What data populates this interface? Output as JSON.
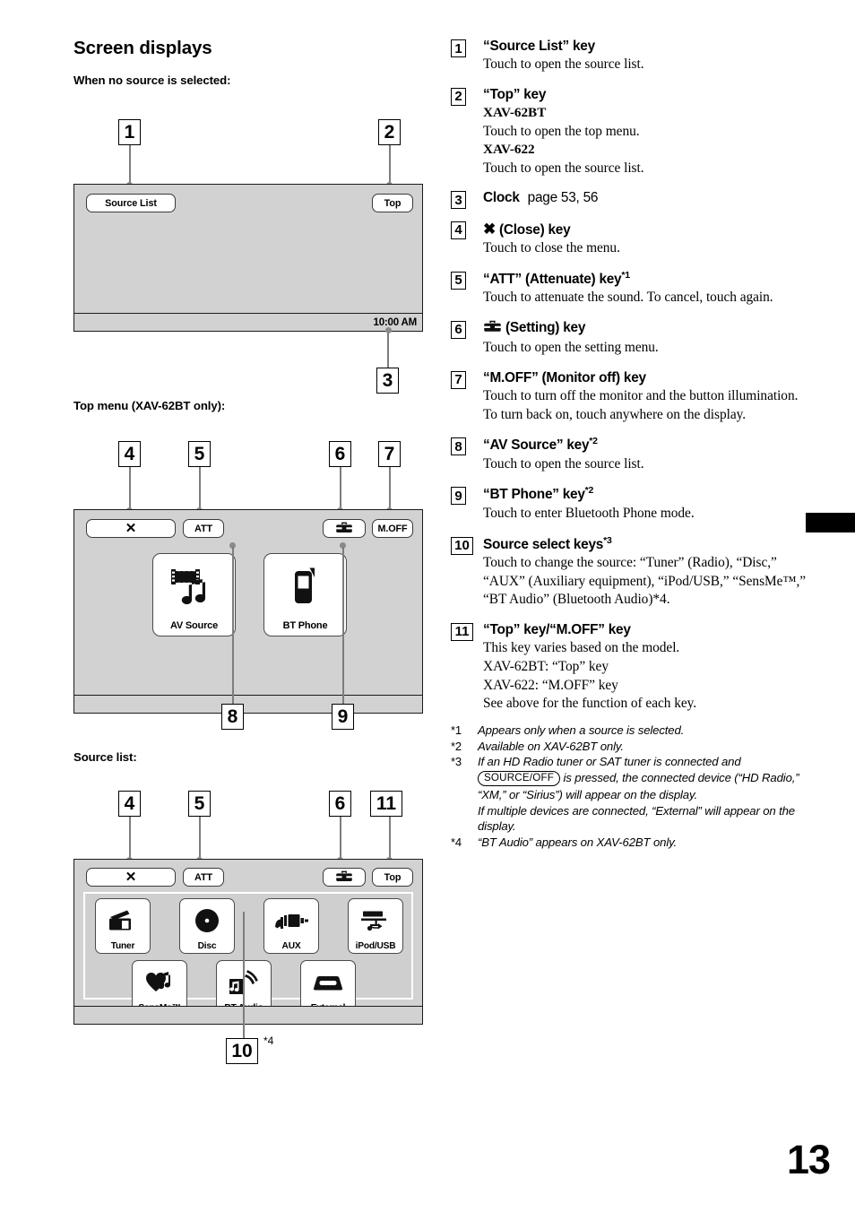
{
  "page": {
    "number": "13",
    "section_title": "Screen displays"
  },
  "left": {
    "fig1": {
      "caption": "When no source is selected:",
      "callouts": [
        {
          "id": "1",
          "label": "1"
        },
        {
          "id": "2",
          "label": "2"
        },
        {
          "id": "3",
          "label": "3"
        }
      ],
      "source_list_button": "Source List",
      "top_button": "Top",
      "clock": "10:00 AM"
    },
    "fig2": {
      "caption": "Top menu (XAV-62BT only):",
      "callouts": [
        {
          "id": "4",
          "label": "4"
        },
        {
          "id": "5",
          "label": "5"
        },
        {
          "id": "6",
          "label": "6"
        },
        {
          "id": "7",
          "label": "7"
        },
        {
          "id": "8",
          "label": "8"
        },
        {
          "id": "9",
          "label": "9"
        }
      ],
      "close_button": "✕",
      "att_button": "ATT",
      "setting_icon": "toolbox-icon",
      "moff_button": "M.OFF",
      "keys": [
        {
          "label": "AV Source",
          "icon": "film-music-icon"
        },
        {
          "label": "BT Phone",
          "icon": "mobile-phone-icon"
        }
      ]
    },
    "fig3": {
      "caption": "Source list:",
      "callouts": [
        {
          "id": "4",
          "label": "4"
        },
        {
          "id": "5",
          "label": "5"
        },
        {
          "id": "6",
          "label": "6"
        },
        {
          "id": "11",
          "label": "11"
        },
        {
          "id": "10",
          "label": "10"
        }
      ],
      "close_button": "✕",
      "att_button": "ATT",
      "setting_icon": "toolbox-icon",
      "top_button": "Top",
      "callout10_note": "*4",
      "row1": [
        {
          "label": "Tuner",
          "icon": "radio-icon"
        },
        {
          "label": "Disc",
          "icon": "disc-icon"
        },
        {
          "label": "AUX",
          "icon": "aux-plug-icon"
        },
        {
          "label": "iPod/USB",
          "icon": "usb-icon"
        }
      ],
      "row2": [
        {
          "label": "SensMe™",
          "icon": "heart-note-icon"
        },
        {
          "label": "BT Audio",
          "icon": "bluetooth-audio-icon"
        },
        {
          "label": "External",
          "icon": "external-device-icon"
        }
      ]
    }
  },
  "right": {
    "items": [
      {
        "num": "1",
        "header": "“Source List” key",
        "lines": [
          {
            "style": "desc",
            "text": "Touch to open the source list."
          }
        ]
      },
      {
        "num": "2",
        "header": "“Top” key",
        "lines": [
          {
            "style": "bold",
            "text": "XAV-62BT"
          },
          {
            "style": "desc",
            "text": "Touch to open the top menu."
          },
          {
            "style": "bold",
            "text": "XAV-622"
          },
          {
            "style": "desc",
            "text": "Touch to open the source list."
          }
        ]
      },
      {
        "num": "3",
        "header": "Clock",
        "header_suffix": "page 53, 56",
        "lines": []
      },
      {
        "num": "4",
        "header": "✖ (Close) key",
        "lines": [
          {
            "style": "desc",
            "text": "Touch to close the menu."
          }
        ]
      },
      {
        "num": "5",
        "header": "“ATT” (Attenuate) key",
        "header_sup": "*1",
        "lines": [
          {
            "style": "desc",
            "text": "Touch to attenuate the sound. To cancel, touch again."
          }
        ]
      },
      {
        "num": "6",
        "header": "(Setting) key",
        "header_icon": "toolbox-icon",
        "lines": [
          {
            "style": "desc",
            "text": "Touch to open the setting menu."
          }
        ]
      },
      {
        "num": "7",
        "header": "“M.OFF” (Monitor off) key",
        "lines": [
          {
            "style": "desc",
            "text": "Touch to turn off the monitor and the button illumination. To turn back on, touch anywhere on the display."
          }
        ]
      },
      {
        "num": "8",
        "header": "“AV Source” key",
        "header_sup": "*2",
        "lines": [
          {
            "style": "desc",
            "text": "Touch to open the source list."
          }
        ]
      },
      {
        "num": "9",
        "header": "“BT Phone” key",
        "header_sup": "*2",
        "lines": [
          {
            "style": "desc",
            "text": "Touch to enter Bluetooth Phone mode."
          }
        ]
      },
      {
        "num": "10",
        "header": "Source select keys",
        "header_sup": "*3",
        "lines": [
          {
            "style": "desc",
            "text": "Touch to change the source: “Tuner” (Radio), “Disc,” “AUX” (Auxiliary equipment), “iPod/USB,” “SensMe™,” “BT Audio” (Bluetooth Audio)*4."
          }
        ]
      },
      {
        "num": "11",
        "header": "“Top” key/“M.OFF” key",
        "lines": [
          {
            "style": "desc",
            "text": "This key varies based on the model."
          },
          {
            "style": "desc",
            "text": "XAV-62BT: “Top” key"
          },
          {
            "style": "desc",
            "text": "XAV-622: “M.OFF” key"
          },
          {
            "style": "desc",
            "text": "See above for the function of each key."
          }
        ]
      }
    ],
    "footnotes": [
      {
        "mark": "*1",
        "text": "Appears only when a source is selected."
      },
      {
        "mark": "*2",
        "text": "Available on XAV-62BT only."
      },
      {
        "mark": "*3",
        "pre": "If an HD Radio tuner or SAT tuner is connected and ",
        "button": "SOURCE/OFF",
        "post": " is pressed, the connected device (“HD Radio,” “XM,” or “Sirius”) will appear on the display.",
        "post2": "If multiple devices are connected, “External” will appear on the display."
      },
      {
        "mark": "*4",
        "text": "“BT Audio” appears on XAV-62BT only."
      }
    ]
  }
}
